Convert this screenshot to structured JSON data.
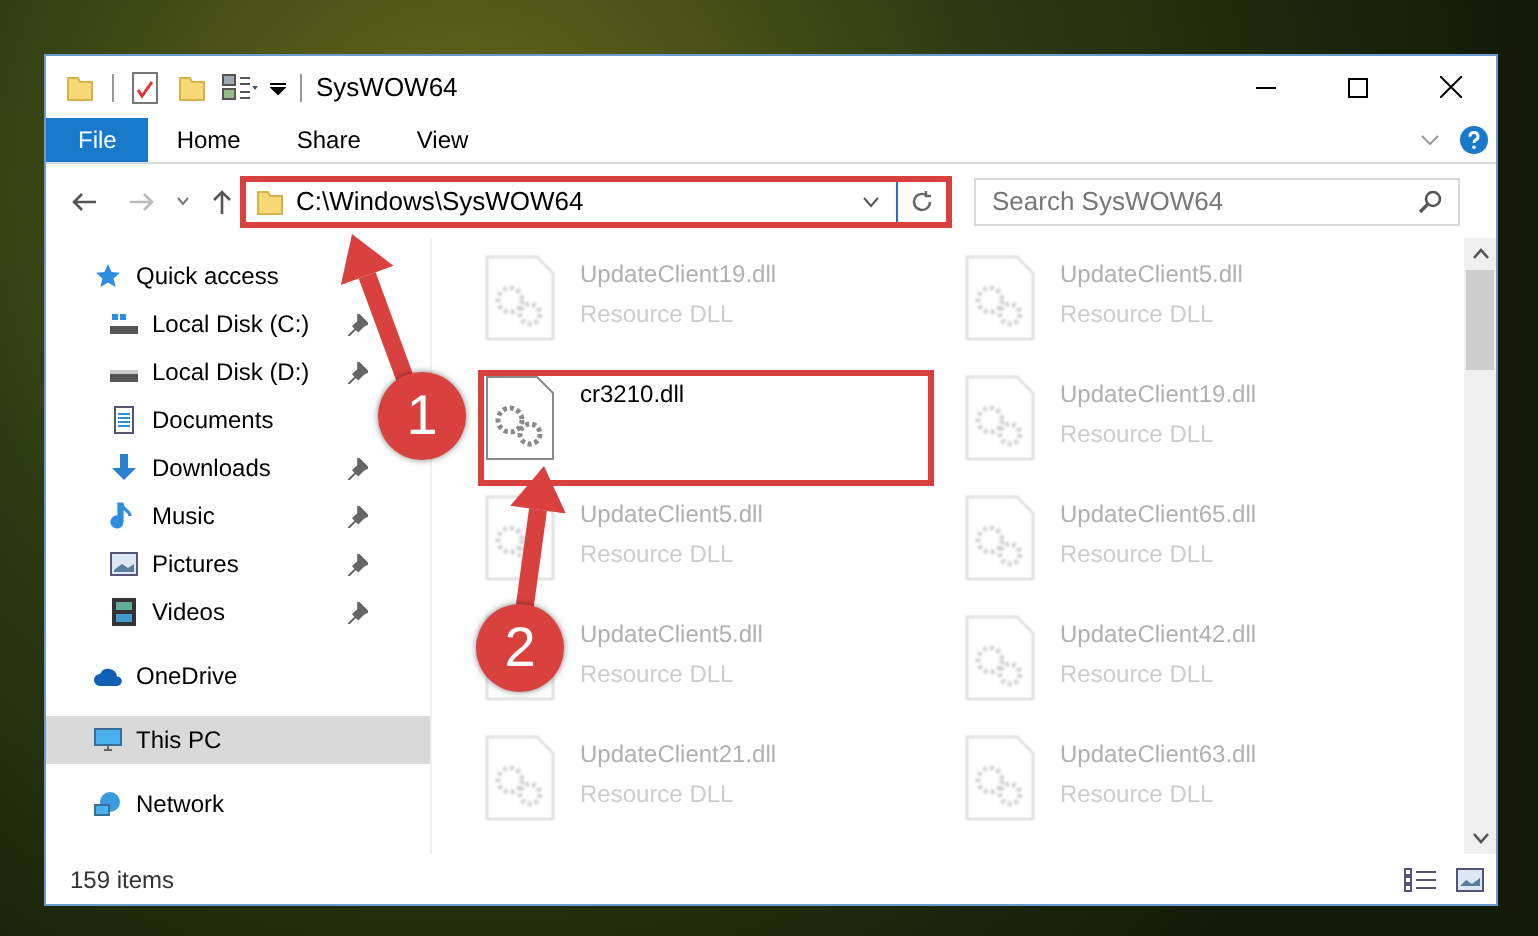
{
  "window": {
    "title": "SysWOW64"
  },
  "ribbon_tabs": [
    {
      "label": "File",
      "kind": "file"
    },
    {
      "label": "Home",
      "kind": "tab"
    },
    {
      "label": "Share",
      "kind": "tab"
    },
    {
      "label": "View",
      "kind": "tab"
    }
  ],
  "address": {
    "path": "C:\\Windows\\SysWOW64",
    "highlighted": true
  },
  "search": {
    "placeholder": "Search SysWOW64"
  },
  "nav": [
    {
      "label": "Quick access",
      "kind": "star",
      "selected": false,
      "children": [
        {
          "label": "Local Disk (C:)",
          "kind": "drive-c",
          "pinned": true,
          "selected": false
        },
        {
          "label": "Local Disk (D:)",
          "kind": "drive",
          "pinned": true,
          "selected": false
        },
        {
          "label": "Documents",
          "kind": "documents",
          "pinned": false,
          "selected": false
        },
        {
          "label": "Downloads",
          "kind": "downloads",
          "pinned": true,
          "selected": false
        },
        {
          "label": "Music",
          "kind": "music",
          "pinned": true,
          "selected": false
        },
        {
          "label": "Pictures",
          "kind": "pictures",
          "pinned": true,
          "selected": false
        },
        {
          "label": "Videos",
          "kind": "videos",
          "pinned": true,
          "selected": false
        }
      ]
    },
    {
      "label": "OneDrive",
      "kind": "cloud",
      "selected": false
    },
    {
      "label": "This PC",
      "kind": "pc",
      "selected": true
    },
    {
      "label": "Network",
      "kind": "network",
      "selected": false
    }
  ],
  "files": [
    {
      "name": "UpdateClient19.dll",
      "subtitle": "Resource DLL",
      "blurred": true,
      "highlighted": false
    },
    {
      "name": "UpdateClient5.dll",
      "subtitle": "Resource DLL",
      "blurred": true,
      "highlighted": false
    },
    {
      "name": "cr3210.dll",
      "blurred": false,
      "highlighted": true
    },
    {
      "name": "UpdateClient19.dll",
      "subtitle": "Resource DLL",
      "blurred": true,
      "highlighted": false
    },
    {
      "name": "UpdateClient5.dll",
      "subtitle": "Resource DLL",
      "blurred": true,
      "highlighted": false
    },
    {
      "name": "UpdateClient65.dll",
      "subtitle": "Resource DLL",
      "blurred": true,
      "highlighted": false
    },
    {
      "name": "UpdateClient5.dll",
      "subtitle": "Resource DLL",
      "blurred": true,
      "highlighted": false
    },
    {
      "name": "UpdateClient42.dll",
      "subtitle": "Resource DLL",
      "blurred": true,
      "highlighted": false
    },
    {
      "name": "UpdateClient21.dll",
      "subtitle": "Resource DLL",
      "blurred": true,
      "highlighted": false
    },
    {
      "name": "UpdateClient63.dll",
      "subtitle": "Resource DLL",
      "blurred": true,
      "highlighted": false
    }
  ],
  "status_bar": {
    "item_count": "159 items"
  },
  "annotations": [
    {
      "label": "1"
    },
    {
      "label": "2"
    }
  ]
}
